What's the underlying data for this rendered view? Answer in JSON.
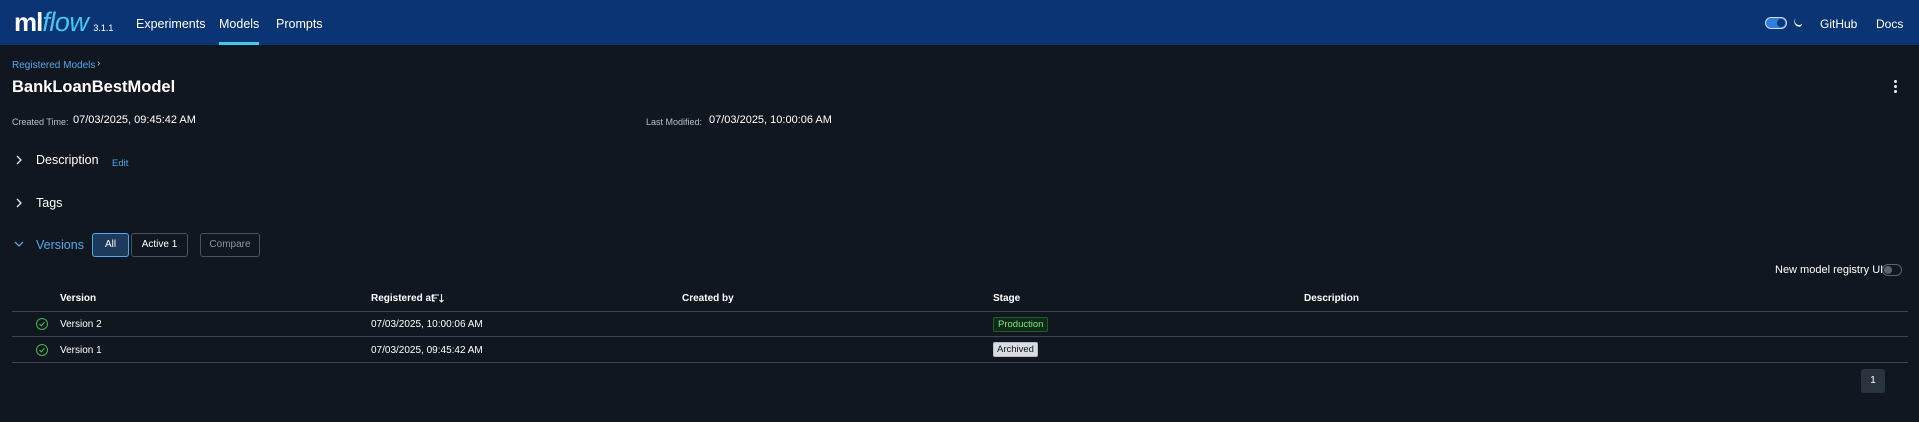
{
  "header": {
    "logo_ml": "ml",
    "logo_flow": "flow",
    "version": "3.1.1",
    "nav": [
      {
        "label": "Experiments"
      },
      {
        "label": "Models",
        "active": true
      },
      {
        "label": "Prompts"
      }
    ],
    "github_label": "GitHub",
    "docs_label": "Docs",
    "dark_mode_icon": "moon-icon",
    "accent_color": "#43c9ed",
    "background_color": "#0a3474"
  },
  "breadcrumb": {
    "registered_models": "Registered Models",
    "separator": "›"
  },
  "model": {
    "name": "BankLoanBestModel",
    "created_label": "Created Time:",
    "created_value": "07/03/2025, 09:45:42 AM",
    "modified_label": "Last Modified:",
    "modified_value": "07/03/2025, 10:00:06 AM"
  },
  "sections": {
    "description": {
      "title": "Description",
      "edit_label": "Edit"
    },
    "tags": {
      "title": "Tags"
    },
    "versions": {
      "title": "Versions"
    }
  },
  "filters": {
    "all_label": "All",
    "active_label": "Active 1",
    "compare_label": "Compare"
  },
  "registry_toggle_label": "New model registry UI",
  "table": {
    "columns": [
      "Version",
      "Registered at",
      "Created by",
      "Stage",
      "Description"
    ],
    "sort_icon": "sort-descending-icon",
    "rows": [
      {
        "version": "Version 2",
        "registered_at": "07/03/2025, 10:00:06 AM",
        "created_by": "",
        "stage": "Production",
        "description": ""
      },
      {
        "version": "Version 1",
        "registered_at": "07/03/2025, 09:45:42 AM",
        "created_by": "",
        "stage": "Archived",
        "description": ""
      }
    ]
  },
  "pagination": {
    "current_page": "1"
  }
}
